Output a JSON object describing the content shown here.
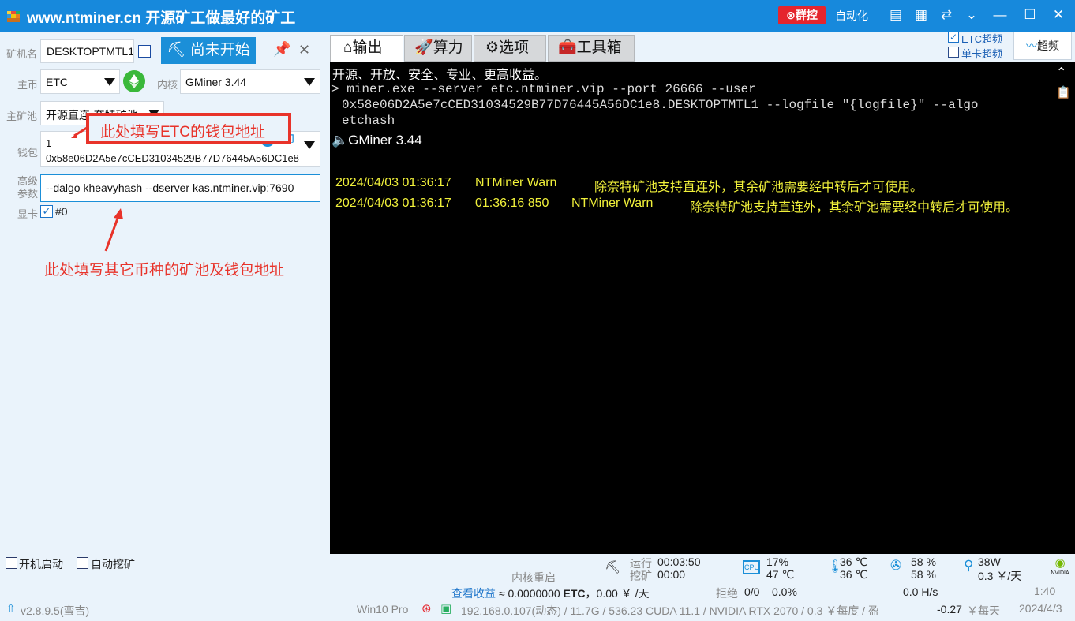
{
  "titlebar": {
    "title": "www.ntminer.cn 开源矿工做最好的矿工",
    "group_control": "群控",
    "auto": "自动化"
  },
  "left": {
    "miner_name_label": "矿机名",
    "miner_name_value": "DESKTOPTMTL1",
    "start_button": "尚未开始",
    "coin_label": "主币",
    "coin_value": "ETC",
    "kernel_label": "内核",
    "kernel_value": "GMiner 3.44",
    "pool_label": "主矿池",
    "pool_value": "开源直连-奈特矿池",
    "wallet_label": "钱包",
    "wallet_line1": "1",
    "wallet_line2": "0x58e06D2A5e7cCED31034529B77D76445A56DC1e8",
    "adv_label_1": "高级",
    "adv_label_2": "参数",
    "adv_value": "--dalgo kheavyhash --dserver kas.ntminer.vip:7690",
    "gpu_label": "显卡",
    "gpu_value": "#0"
  },
  "annotations": {
    "wallet_note": "此处填写ETC的钱包地址",
    "adv_note": "此处填写其它币种的矿池及钱包地址"
  },
  "tabs": [
    {
      "label": "输出",
      "icon": "home-icon"
    },
    {
      "label": "算力",
      "icon": "rocket-icon"
    },
    {
      "label": "选项",
      "icon": "gear-icon"
    },
    {
      "label": "工具箱",
      "icon": "toolbox-icon"
    }
  ],
  "overclock": {
    "etc_label": "ETC超频",
    "etc_checked": true,
    "single_label": "单卡超频",
    "single_checked": false,
    "button": "超频"
  },
  "console": {
    "line1": "开源、开放、安全、专业、更高收益。",
    "cmd1": "> miner.exe --server etc.ntminer.vip --port 26666 --user",
    "cmd2": "0x58e06D2A5e7cCED31034529B77D76445A56DC1e8.DESKTOPTMTL1 --logfile \"{logfile}\" --algo",
    "cmd3": "etchash",
    "kernel_line": "GMiner 3.44",
    "warn1": {
      "date": "2024/04/03 01:36:17",
      "src": "NTMiner Warn",
      "msg": "除奈特矿池支持直连外，其余矿池需要经中转后才可使用。"
    },
    "warn2": {
      "date": "2024/04/03 01:36:17",
      "time2": "01:36:16 850",
      "src": "NTMiner Warn",
      "msg": "除奈特矿池支持直连外，其余矿池需要经中转后才可使用。"
    }
  },
  "status": {
    "boot_start": "开机启动",
    "auto_mine": "自动挖矿",
    "kernel_restart": "内核重启",
    "view_income": "查看收益",
    "income": "≈ 0.0000000",
    "income_coin": "ETC",
    "income_cny": "，0.00 ￥ /天",
    "run_label": "运行",
    "run_value": "00:03:50",
    "mine_label": "挖矿",
    "mine_value": "00:00",
    "cpu1": "17%",
    "cpu2": "47 ℃",
    "temp1": "36 ℃",
    "temp2": "36 ℃",
    "fan1": "58 %",
    "fan2": "58 %",
    "power1": "38W",
    "power2": "0.3 ￥/天",
    "reject_label": "拒绝",
    "reject_value": "0/0",
    "reject_pct": "0.0%",
    "hashrate": "0.0 H/s",
    "version": "v2.8.9.5(蛮吉)",
    "os": "Win10 Pro",
    "sysinfo": "192.168.0.107(动态) / 11.7G / 536.23 CUDA 11.1 / NVIDIA RTX 2070 / 0.3 ￥每度 / 盈",
    "profit": "-0.27",
    "profit_unit": "￥每天",
    "time": "1:40",
    "date": "2024/4/3",
    "nvidia": "NVIDIA"
  },
  "colors": {
    "accent": "#1789dc",
    "warn": "#f0f03a",
    "danger": "#e5252d"
  }
}
